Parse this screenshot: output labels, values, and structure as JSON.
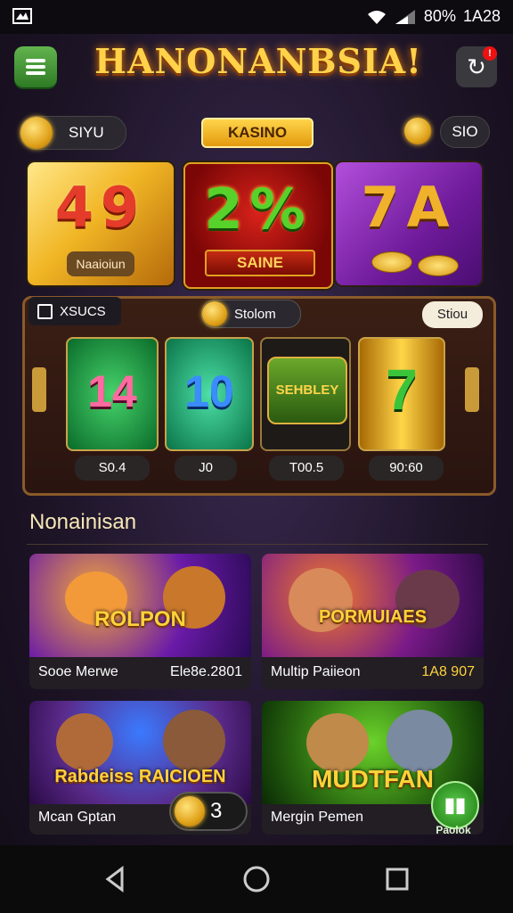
{
  "status_bar": {
    "battery": "80%",
    "time": "1A28",
    "icons": [
      "wifi-icon",
      "signal-icon"
    ]
  },
  "header": {
    "title": "HANONANBSIA!",
    "menu_icon": "hamburger-icon",
    "refresh_icon": "refresh-icon",
    "notification_badge": "!"
  },
  "subheader": {
    "coin_pill_label": "SIYU",
    "badge_label": "KASINO",
    "right_pill_label": "SIO"
  },
  "featured": [
    {
      "number": "49",
      "label": "Naaioiun"
    },
    {
      "number": "2%",
      "label": "SAINE"
    },
    {
      "number": "7A",
      "label": ""
    }
  ],
  "slot": {
    "search_label": "XSUCS",
    "center_label": "Stolom",
    "show_label": "Stiou",
    "reels": [
      {
        "symbol": "14",
        "value": "S0.4"
      },
      {
        "symbol": "10",
        "value": "J0"
      },
      {
        "symbol": "SEHBLEY",
        "value": "T00.5"
      },
      {
        "symbol": "7",
        "value": "90:60"
      }
    ]
  },
  "section": {
    "title": "Nonainisan"
  },
  "games": [
    {
      "title": "ROLPON",
      "name": "Sooe Merwe",
      "value": "Ele8e.2801"
    },
    {
      "title": "PORMUIAES",
      "name": "Multip Paiieon",
      "value": "1A8 907"
    },
    {
      "title": "Rabdeiss RAICIOEN",
      "name": "Mcan Gptan",
      "value": ""
    },
    {
      "title": "MUDTFAN",
      "name": "Mergin Pemen",
      "value": ""
    }
  ],
  "toggle": {
    "value": "3"
  },
  "play_button": {
    "label": "Paolok"
  },
  "colors": {
    "accent_gold": "#ffd24a",
    "menu_green": "#4a9a3a",
    "bg": "#1d1426"
  }
}
